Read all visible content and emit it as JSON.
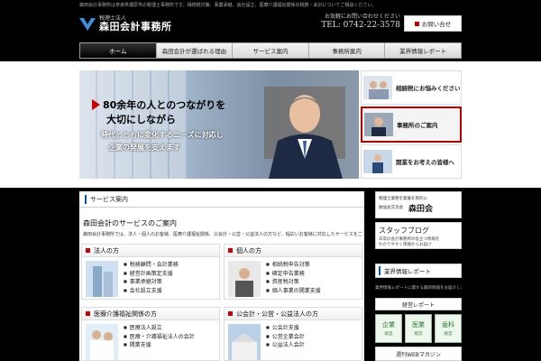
{
  "tagline": "森田会計事務所は奈良県橿原市の税理士事務所です。相続税対策、事業承継、会社設立、医療介護福祉関係の税務・会計についてご相談ください。",
  "header": {
    "logo_sub": "税理士法人",
    "logo_name": "森田会計事務所",
    "contact_label": "お気軽にお問い合わせください",
    "contact_tel": "TEL: 0742-22-3578",
    "inquiry_label": "お問い合せ"
  },
  "nav": {
    "items": [
      {
        "label": "ホーム"
      },
      {
        "label": "森田会計が選ばれる理由"
      },
      {
        "label": "サービス案内"
      },
      {
        "label": "事務所案内"
      },
      {
        "label": "業界情報レポート"
      }
    ]
  },
  "hero": {
    "line1": "80余年の人とのつながりを",
    "line2": "大切にしながら",
    "line3": "時代とともに変化するニーズに対応し",
    "line4": "企業の発展を支えます"
  },
  "side_tabs": [
    {
      "label": "相続税にお悩みください"
    },
    {
      "label": "事務所のご案内"
    },
    {
      "label": "開業をお考えの皆様へ"
    }
  ],
  "main": {
    "section_title": "サービス案内",
    "intro_title": "森田会計のサービスのご案内",
    "intro_text": "森田会計事務所では、法人・個人のお客様、医療介護福祉関係、公会計・公営・公益法人の方など、幅広いお客様に対応したサービスをご提供しております。",
    "cards": [
      {
        "title": "法人の方",
        "items": [
          "税務顧問・会計業務",
          "経営計画策定支援",
          "事業承継対策",
          "会社設立支援"
        ]
      },
      {
        "title": "個人の方",
        "items": [
          "相続税申告対策",
          "確定申告業務",
          "資産税対策",
          "個人事業の開業支援"
        ]
      },
      {
        "title": "医療介護福祉関係の方",
        "items": [
          "医療法人設立",
          "医療・介護福祉法人の会計",
          "開業支援"
        ]
      },
      {
        "title": "公会計・公営・公益法人の方",
        "items": [
          "公会計支援",
          "公営企業会計",
          "公益法人会計"
        ]
      }
    ]
  },
  "sidebar": {
    "morita_sub": "税理士業務を発展を目的に",
    "morita_sub2": "勉強会交流会",
    "morita_name": "森田会",
    "blog_title": "スタッフブログ",
    "blog_desc1": "日常の会計事務所の役立つ情報を",
    "blog_desc2": "わかりやすく情報からお届け",
    "report_heading": "業界情報レポート",
    "report_note": "業界情報レポートに関する最新情報をお届けします。",
    "keiei_label": "経営レポート",
    "tiles": [
      {
        "t1": "企業",
        "t2": "経営"
      },
      {
        "t1": "医業",
        "t2": "経営"
      },
      {
        "t1": "歯科",
        "t2": "経営"
      }
    ],
    "web_mag": "週刊WEBマガジン"
  },
  "colors": {
    "accent": "#cc0000",
    "nav_active": "#000000",
    "heading_bar": "#0055aa"
  }
}
